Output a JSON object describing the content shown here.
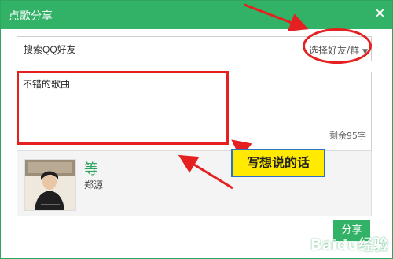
{
  "dialog": {
    "title": "点歌分享",
    "close_label": "✕",
    "search_placeholder": "搜索QQ好友",
    "select_friends_label": "选择好友/群",
    "message_text": "不错的歌曲",
    "remaining_chars": "剩余95字",
    "song": {
      "title": "等",
      "artist": "郑源"
    },
    "share_button_label": "分享"
  },
  "annotation": {
    "callout_text": "写想说的话",
    "color": "#e42020"
  },
  "watermark": "Baidu经验"
}
